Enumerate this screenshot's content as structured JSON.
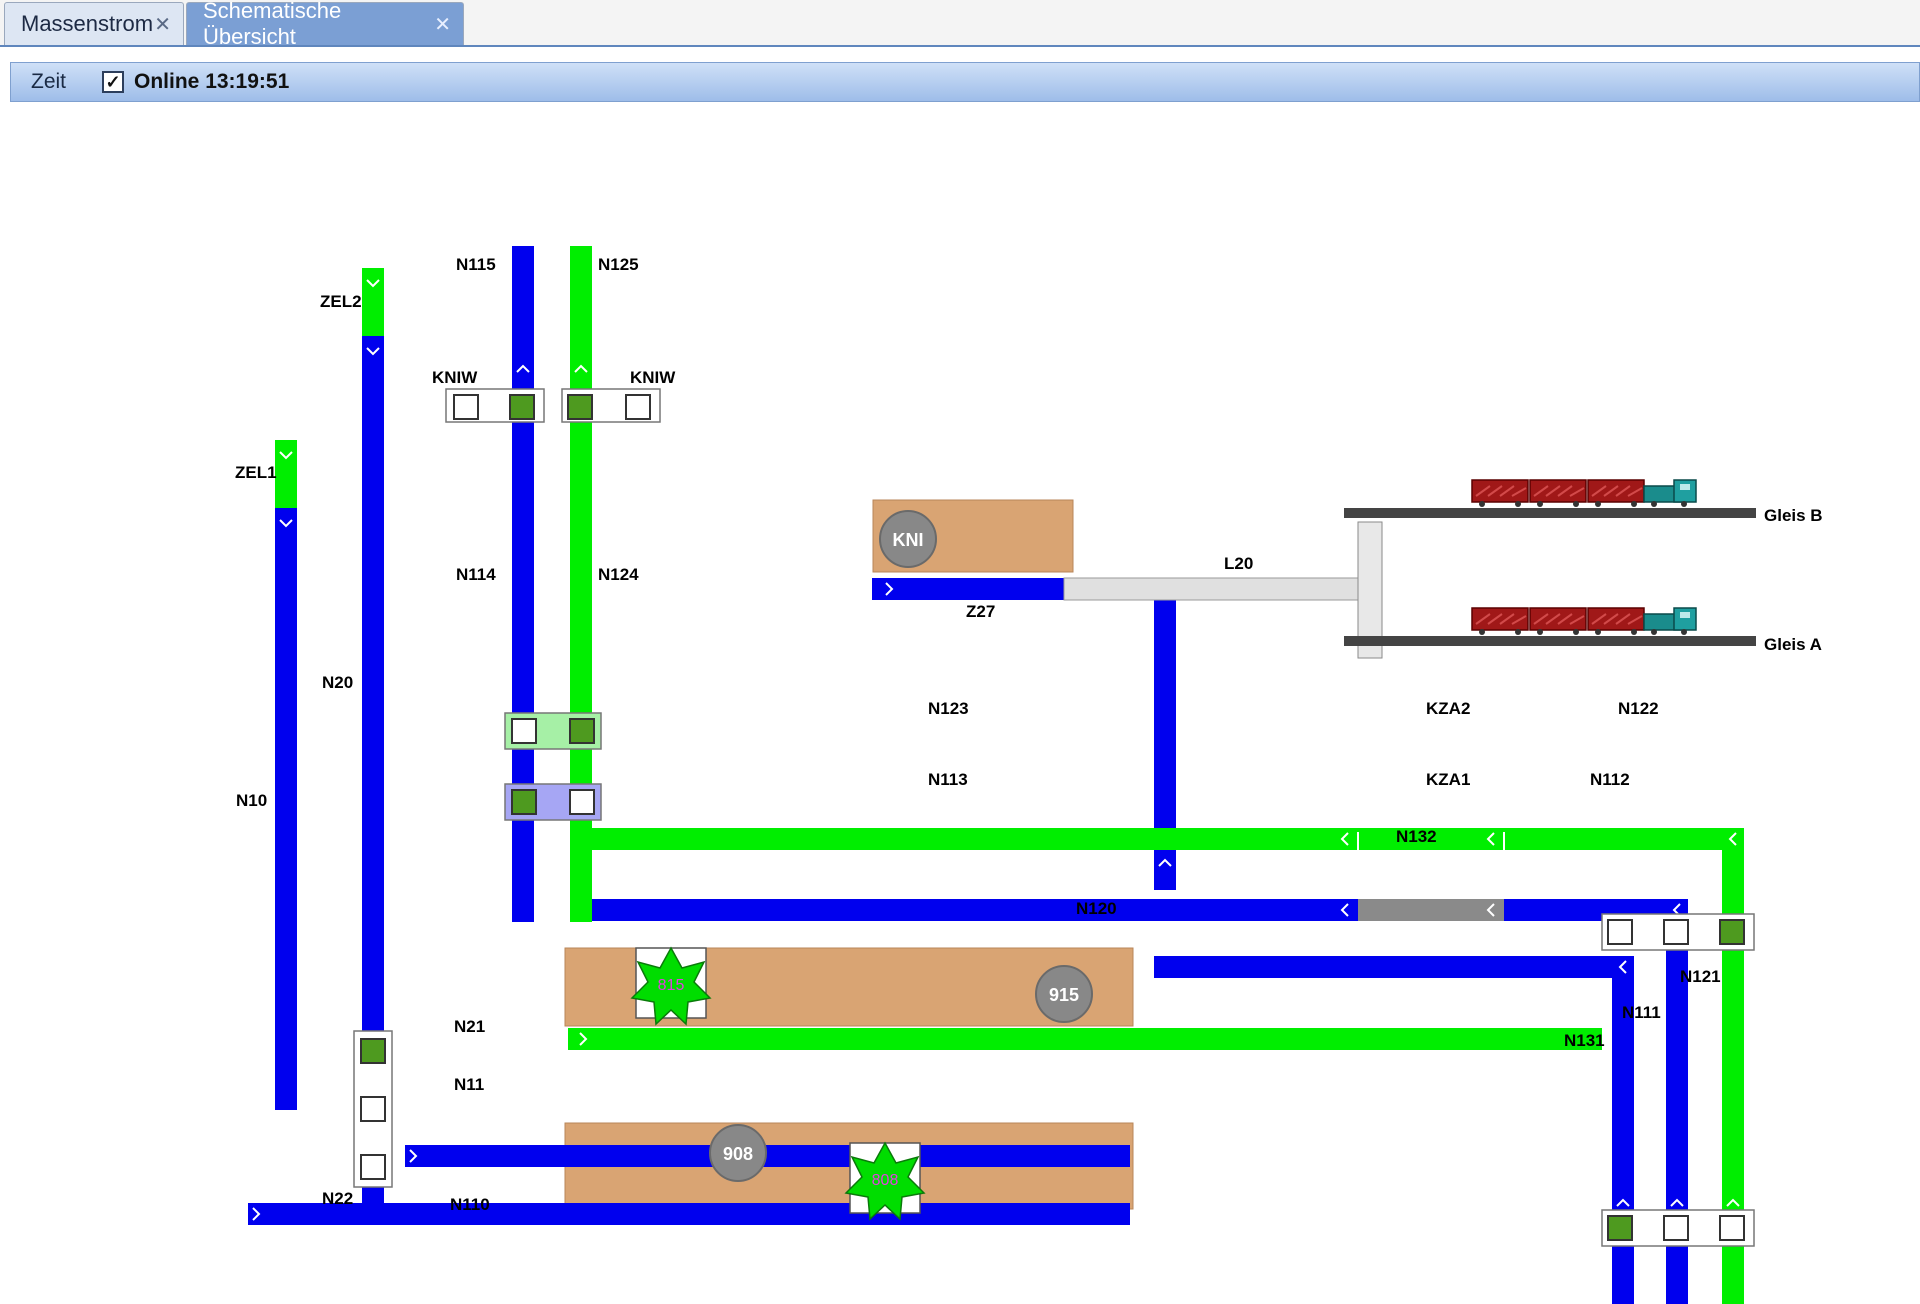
{
  "tabs": [
    {
      "label": "Massenstrom",
      "close": "✕"
    },
    {
      "label": "Schematische Übersicht",
      "close": "✕"
    }
  ],
  "toolbar": {
    "zeit": "Zeit",
    "online_checked": true,
    "check_mark": "✓",
    "online_label": "Online 13:19:51"
  },
  "colors": {
    "blue": "#0000ee",
    "green": "#00ee00",
    "gray": "#8a8a8a",
    "bunker": "#d9a473",
    "valve_on": "#4e9a1f"
  },
  "labels": {
    "zel2": "ZEL2",
    "zel1": "ZEL1",
    "n115": "N115",
    "n125": "N125",
    "kniw_left": "KNIW",
    "kniw_right": "KNIW",
    "n114": "N114",
    "n124": "N124",
    "n20": "N20",
    "n10": "N10",
    "kni": "KNI",
    "z27": "Z27",
    "l20": "L20",
    "gleis_b": "Gleis B",
    "gleis_a": "Gleis A",
    "n123": "N123",
    "kza2": "KZA2",
    "n122": "N122",
    "n113": "N113",
    "kza1": "KZA1",
    "n112": "N112",
    "n132": "N132",
    "n120": "N120",
    "n121": "N121",
    "n111": "N111",
    "n131": "N131",
    "n21": "N21",
    "n11": "N11",
    "n22": "N22",
    "n110": "N110",
    "silo_915": "915",
    "silo_908": "908",
    "mill_815": "815",
    "mill_808": "808"
  }
}
